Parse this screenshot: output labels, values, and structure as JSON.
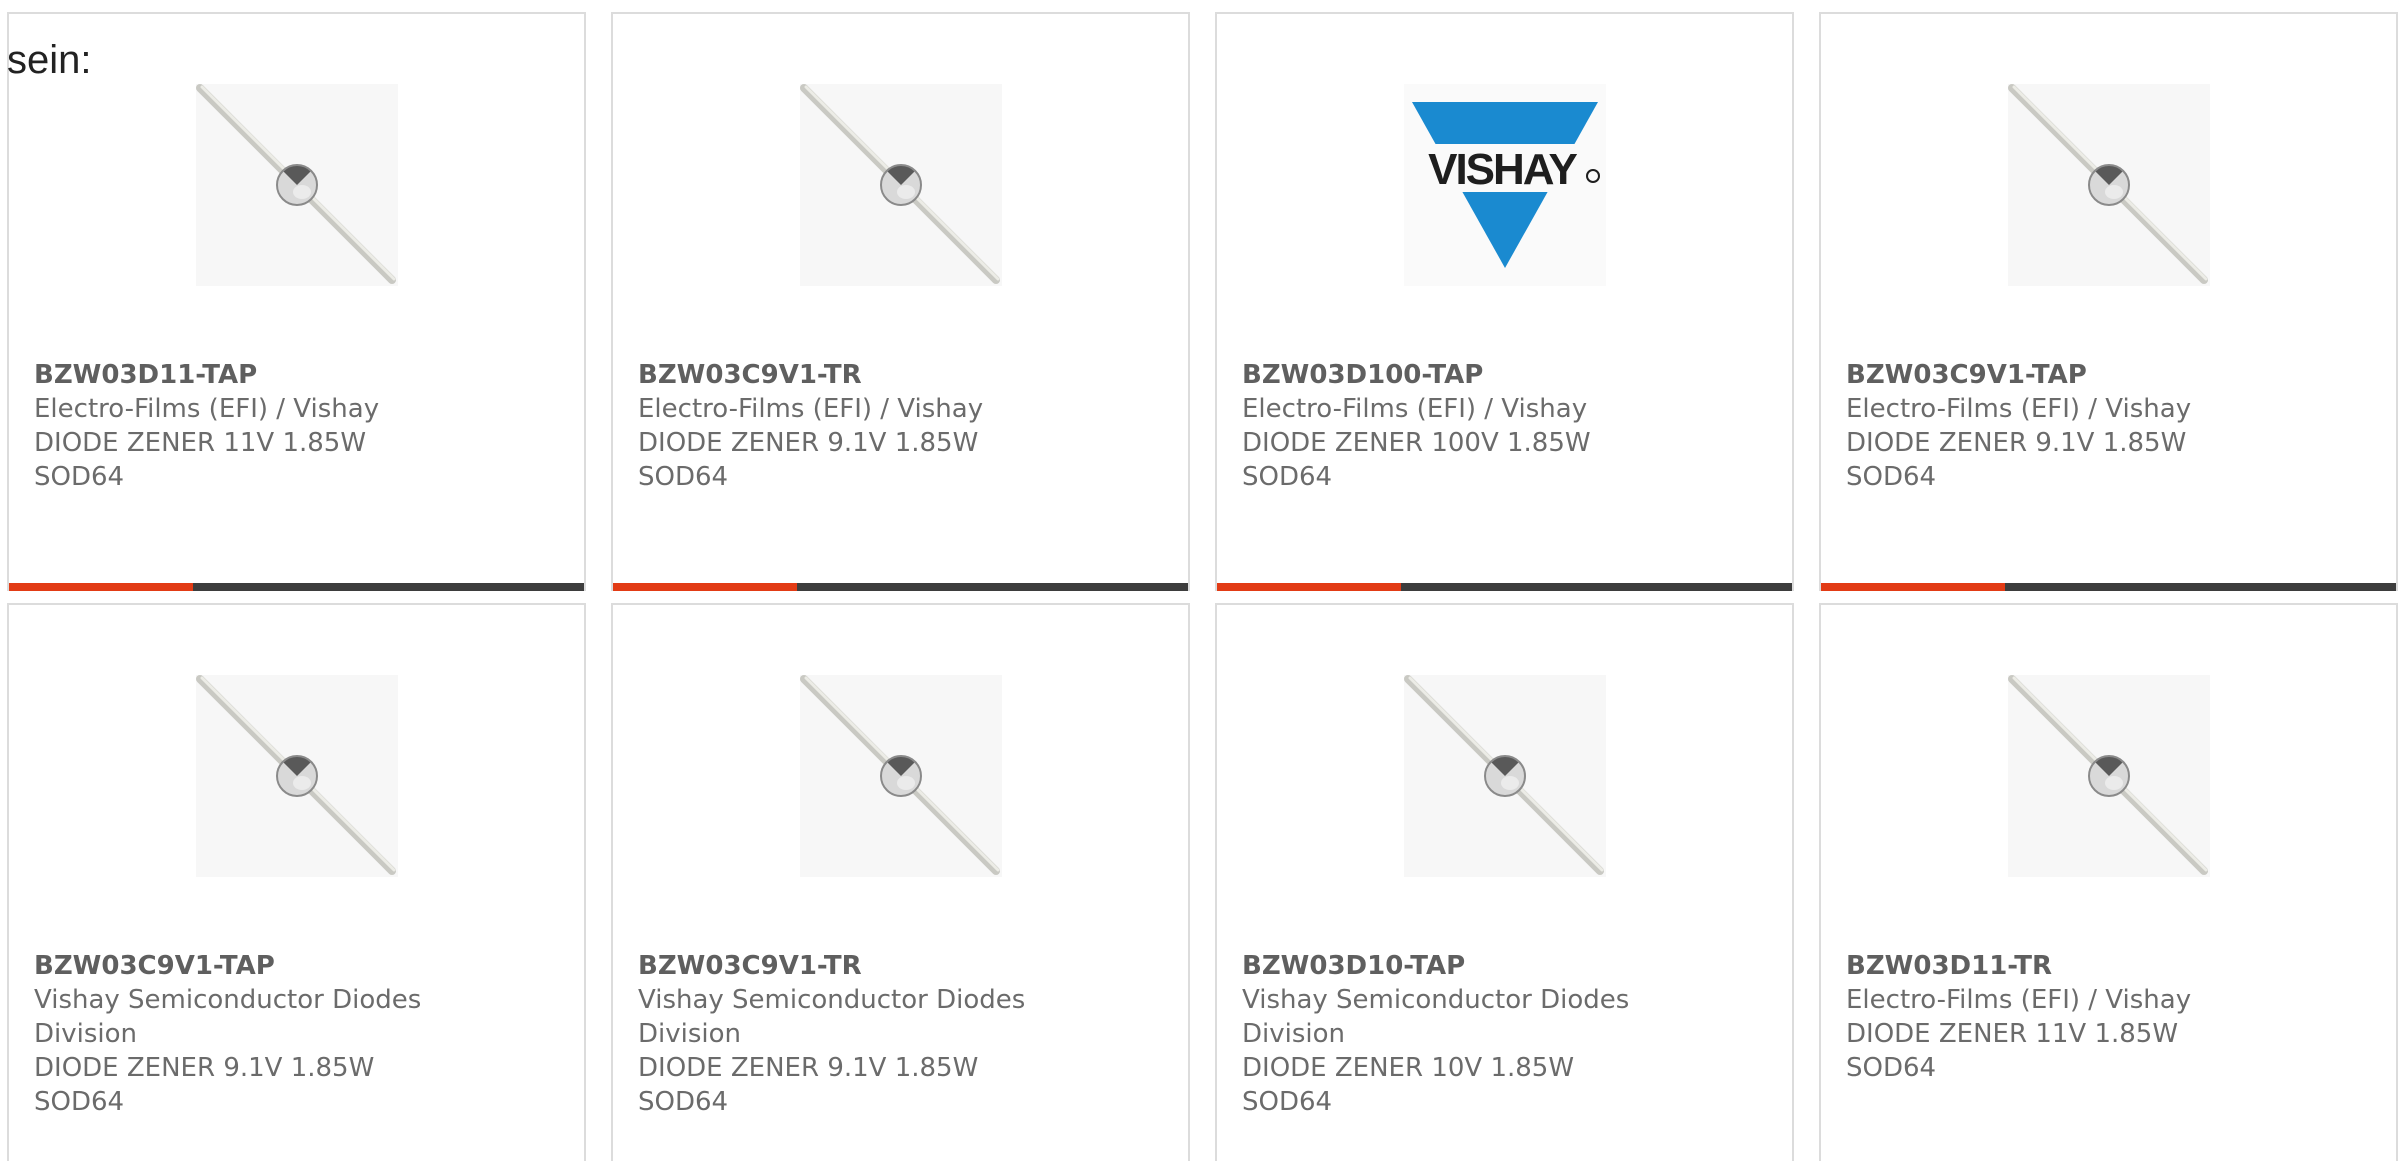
{
  "intro_text": "sein:",
  "colors": {
    "accent": "#e23b15",
    "bar_track": "#3d3d3d",
    "card_border": "#dcdcdc",
    "vishay_blue": "#1a8ad0"
  },
  "products": [
    {
      "part_number": "BZW03D11-TAP",
      "manufacturer": "Electro-Films (EFI) / Vishay",
      "description": "DIODE ZENER 11V 1.85W SOD64",
      "image_icon": "diode-image",
      "progress": 0.32
    },
    {
      "part_number": "BZW03C9V1-TR",
      "manufacturer": "Electro-Films (EFI) / Vishay",
      "description": "DIODE ZENER 9.1V 1.85W SOD64",
      "image_icon": "diode-image",
      "progress": 0.32
    },
    {
      "part_number": "BZW03D100-TAP",
      "manufacturer": "Electro-Films (EFI) / Vishay",
      "description": "DIODE ZENER 100V 1.85W SOD64",
      "image_icon": "vishay-logo",
      "logo_text": "VISHAY",
      "progress": 0.32
    },
    {
      "part_number": "BZW03C9V1-TAP",
      "manufacturer": "Electro-Films (EFI) / Vishay",
      "description": "DIODE ZENER 9.1V 1.85W SOD64",
      "image_icon": "diode-image",
      "progress": 0.32
    },
    {
      "part_number": "BZW03C9V1-TAP",
      "manufacturer": "Vishay Semiconductor Diodes Division",
      "description": "DIODE ZENER 9.1V 1.85W SOD64",
      "image_icon": "diode-image"
    },
    {
      "part_number": "BZW03C9V1-TR",
      "manufacturer": "Vishay Semiconductor Diodes Division",
      "description": "DIODE ZENER 9.1V 1.85W SOD64",
      "image_icon": "diode-image"
    },
    {
      "part_number": "BZW03D10-TAP",
      "manufacturer": "Vishay Semiconductor Diodes Division",
      "description": "DIODE ZENER 10V 1.85W SOD64",
      "image_icon": "diode-image"
    },
    {
      "part_number": "BZW03D11-TR",
      "manufacturer": "Electro-Films (EFI) / Vishay",
      "description": "DIODE ZENER 11V 1.85W SOD64",
      "image_icon": "diode-image"
    }
  ]
}
